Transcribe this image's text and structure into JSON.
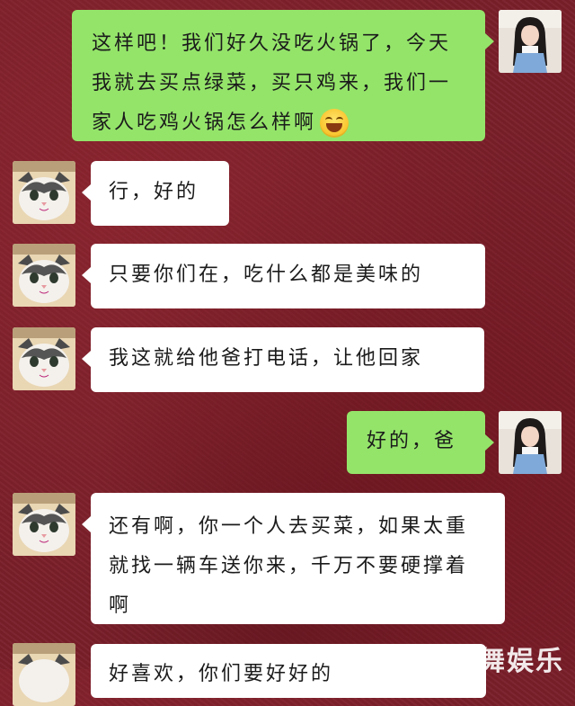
{
  "messages": [
    {
      "side": "out",
      "text": "这样吧！我们好久没吃火锅了，今天我就去买点绿菜，买只鸡来，我们一家人吃鸡火锅怎么样啊",
      "emoji": "grinning-face"
    },
    {
      "side": "in",
      "text": "行，好的"
    },
    {
      "side": "in",
      "text": "只要你们在，吃什么都是美味的"
    },
    {
      "side": "in",
      "text": "我这就给他爸打电话，让他回家"
    },
    {
      "side": "out",
      "text": "好的，爸"
    },
    {
      "side": "in",
      "text": "还有啊，你一个人去买菜，如果太重就找一辆车送你来，千万不要硬撑着啊"
    },
    {
      "side": "in",
      "text": "好喜欢，你们要好好的"
    }
  ],
  "avatars": {
    "self": "girl-avatar",
    "other": "cat-avatar"
  },
  "watermark": "快传号／水舞娱乐",
  "colors": {
    "outgoing": "#94e46a",
    "incoming": "#ffffff"
  }
}
